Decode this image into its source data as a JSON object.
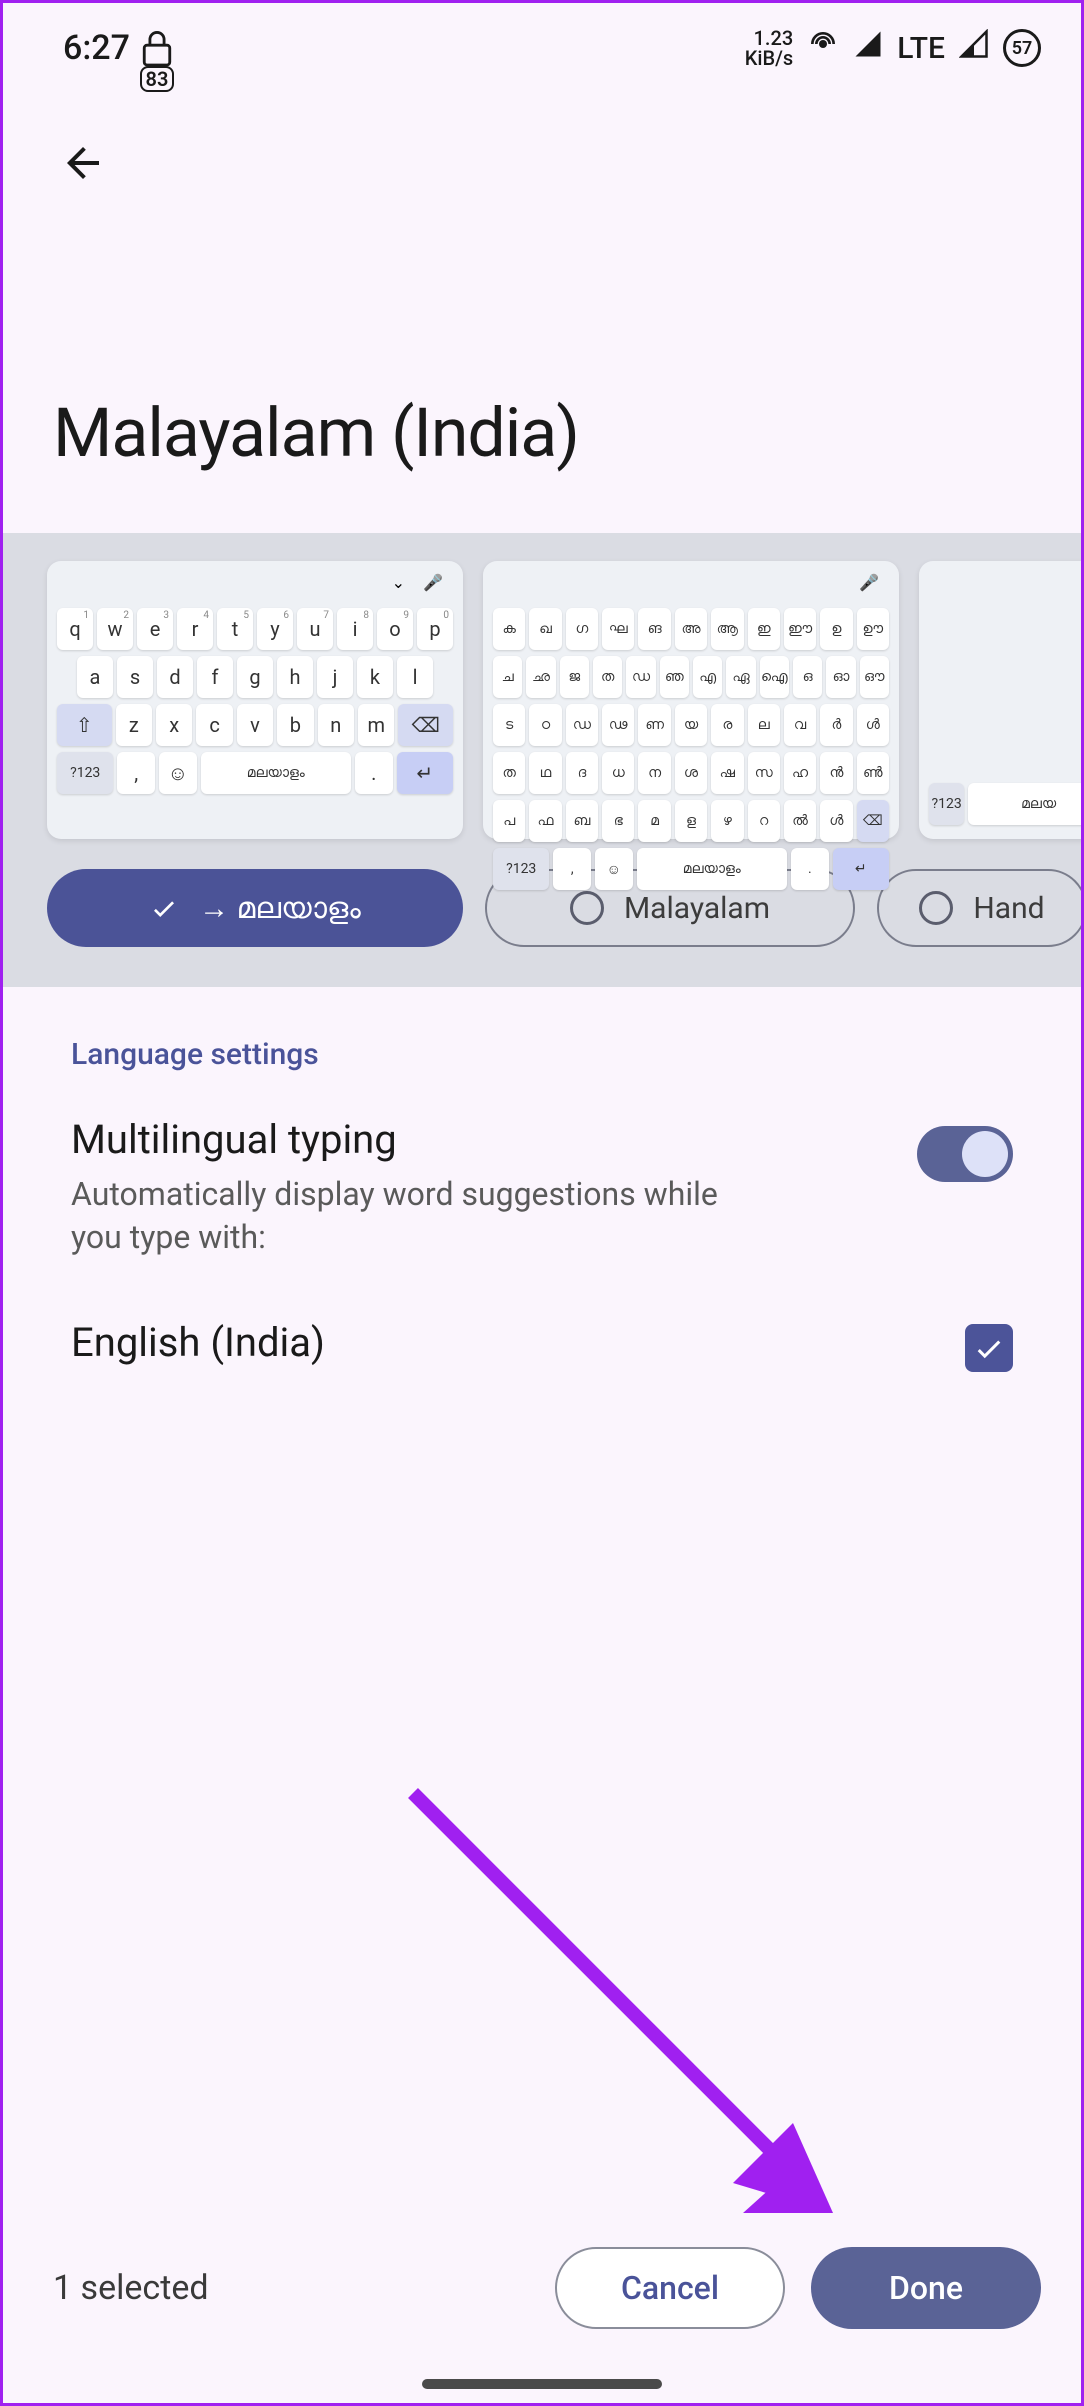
{
  "status": {
    "time": "6:27",
    "lock_num": "83",
    "kib_rate": "1.23",
    "kib_label": "KiB/s",
    "lte": "LTE",
    "battery": "57"
  },
  "page": {
    "title": "Malayalam (India)"
  },
  "keyboards": {
    "preview1_space": "മലയാളം",
    "preview2_space": "മലയാളം",
    "sym_key": "?123"
  },
  "layouts": {
    "selected_label": "→ മലയാളം",
    "option2": "Malayalam",
    "option3": "Hand"
  },
  "settings": {
    "section": "Language settings",
    "ml_title": "Multilingual typing",
    "ml_desc": "Automatically display word suggestions while you type with:",
    "lang1": "English (India)"
  },
  "footer": {
    "count": "1 selected",
    "cancel": "Cancel",
    "done": "Done"
  }
}
